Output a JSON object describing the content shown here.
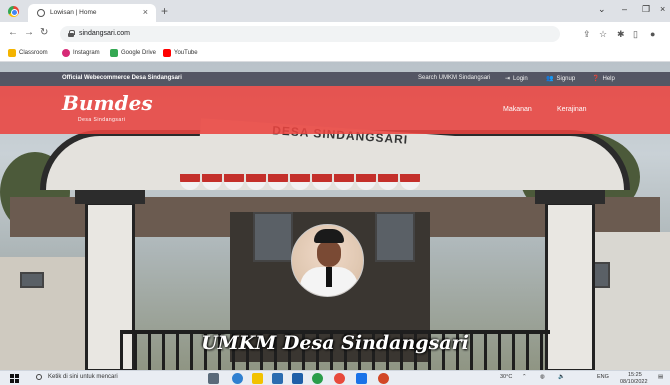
{
  "browser": {
    "tab_title": "Lowisan | Home",
    "url": "sindangsari.com",
    "bookmarks": [
      {
        "label": "Classroom",
        "color": "#f4b400"
      },
      {
        "label": "Instagram",
        "color": "#d62976"
      },
      {
        "label": "Google Drive",
        "color": "#34a853"
      },
      {
        "label": "YouTube",
        "color": "#ff0000"
      }
    ]
  },
  "site": {
    "topbar_left": "Official Webecommerce Desa Sindangsari",
    "topbar_right": {
      "search": "Search UMKM Sindangsari",
      "login": "Login",
      "signup": "Signup",
      "help": "Help"
    },
    "brand": "Bumdes",
    "brand_sub": "Desa Sindangsari",
    "menu": [
      "Makanan",
      "Kerajinan"
    ],
    "gate_sign": "DESA SINDANGSARI",
    "hero_title": "UMKM Desa Sindangsari",
    "accent_color": "#ea4440"
  },
  "taskbar": {
    "search_placeholder": "Ketik di sini untuk mencari",
    "weather": "30°C",
    "time": "15:25",
    "date": "08/10/2022"
  }
}
